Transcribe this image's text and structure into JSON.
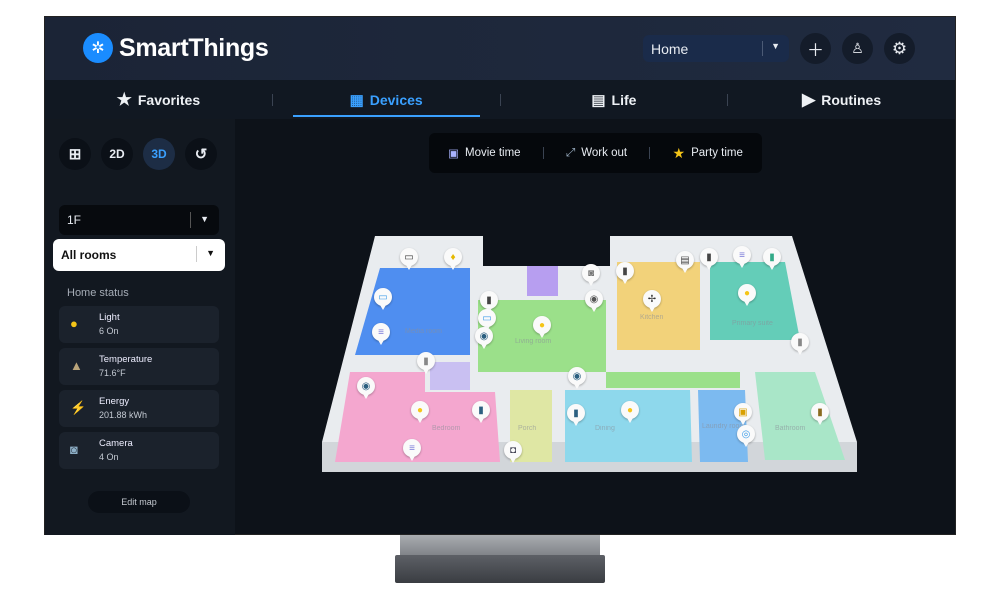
{
  "app": {
    "name": "SmartThings",
    "logo_icon": "smartthings-logo-icon"
  },
  "header": {
    "home_select": "Home",
    "add_icon": "plus-icon",
    "profile_icon": "person-icon",
    "settings_icon": "gear-icon"
  },
  "tabs": [
    {
      "label": "Favorites",
      "icon": "star-icon"
    },
    {
      "label": "Devices",
      "icon": "devices-icon",
      "active": true
    },
    {
      "label": "Life",
      "icon": "life-icon"
    },
    {
      "label": "Routines",
      "icon": "play-icon"
    }
  ],
  "view_buttons": [
    {
      "label": "",
      "icon": "grid-icon"
    },
    {
      "label": "2D"
    },
    {
      "label": "3D",
      "active": true
    },
    {
      "label": "",
      "icon": "history-icon"
    }
  ],
  "floor_select": "1F",
  "room_select": "All rooms",
  "home_status": {
    "title": "Home status",
    "items": [
      {
        "label": "Light",
        "value": "6 On",
        "icon": "bulb-icon"
      },
      {
        "label": "Temperature",
        "value": "71.6°F",
        "icon": "thermometer-icon"
      },
      {
        "label": "Energy",
        "value": "201.88 kWh",
        "icon": "energy-icon"
      },
      {
        "label": "Camera",
        "value": "4 On",
        "icon": "camera-icon"
      }
    ]
  },
  "edit_map": "Edit map",
  "scenes": [
    {
      "label": "Movie time",
      "icon": "projector-icon"
    },
    {
      "label": "Work out",
      "icon": "dumbbell-icon"
    },
    {
      "label": "Party time",
      "icon": "star-icon"
    }
  ],
  "rooms": [
    "Media room",
    "Living room",
    "Kitchen",
    "Primary suite",
    "Bedroom",
    "Porch",
    "Dining",
    "Laundry room",
    "Bathroom"
  ],
  "colors": {
    "accent": "#3aa0ff",
    "header": "#1b2436",
    "background": "#0d1219"
  }
}
